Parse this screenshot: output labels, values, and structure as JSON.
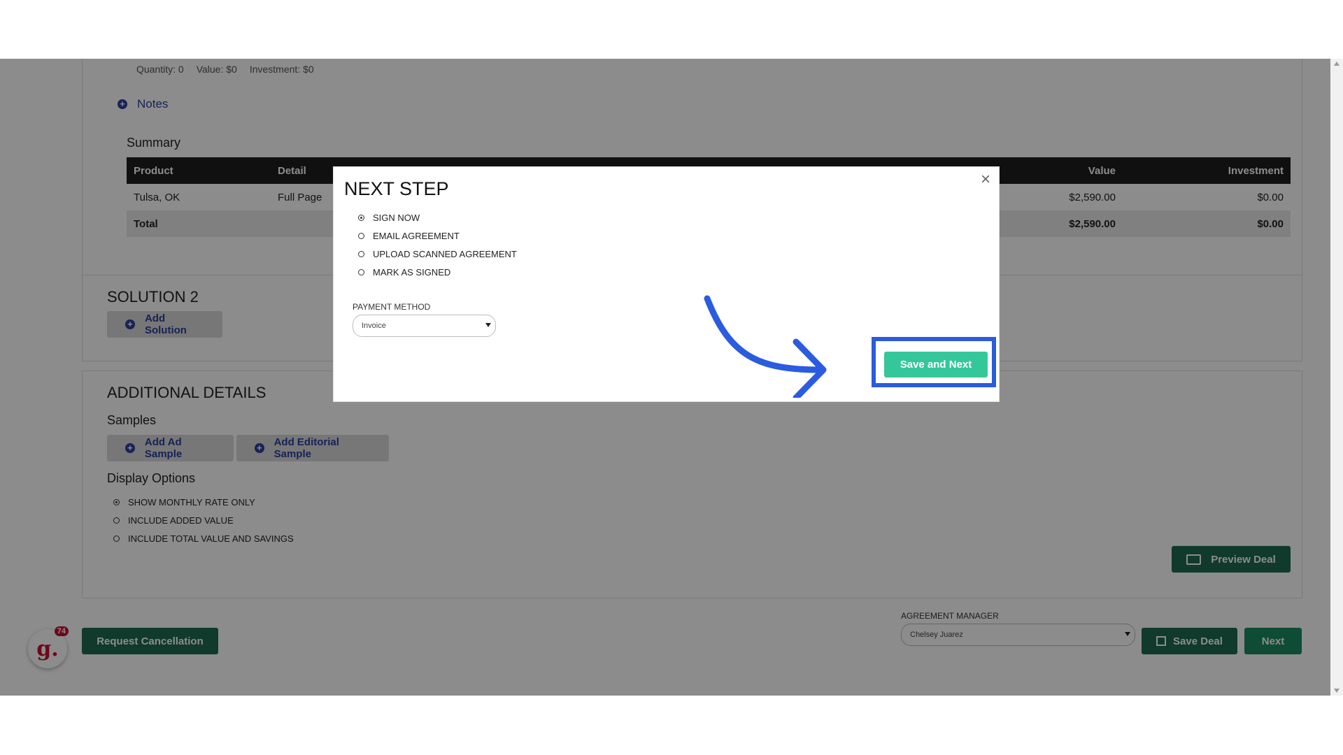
{
  "top_meta": {
    "quantity": "Quantity: 0",
    "value": "Value: $0",
    "investment": "Investment: $0"
  },
  "notes_label": "Notes",
  "summary": {
    "title": "Summary",
    "headers": [
      "Product",
      "Detail",
      "Value",
      "Investment"
    ],
    "rows": [
      {
        "product": "Tulsa, OK",
        "detail": "Full Page",
        "value": "$2,590.00",
        "investment": "$0.00"
      }
    ],
    "total": {
      "label": "Total",
      "value": "$2,590.00",
      "investment": "$0.00"
    }
  },
  "solution2": {
    "title": "SOLUTION 2",
    "add_label": "Add Solution"
  },
  "additional": {
    "title": "ADDITIONAL DETAILS",
    "samples_title": "Samples",
    "add_ad_sample": "Add Ad Sample",
    "add_editorial_sample": "Add Editorial Sample",
    "display_title": "Display Options",
    "display_options": [
      "SHOW MONTHLY RATE ONLY",
      "INCLUDE ADDED VALUE",
      "INCLUDE TOTAL VALUE AND SAVINGS"
    ],
    "preview_label": "Preview Deal"
  },
  "footer": {
    "request_cancellation": "Request Cancellation",
    "agreement_manager_label": "AGREEMENT MANAGER",
    "agreement_manager_value": "Chelsey Juarez",
    "save_deal": "Save Deal",
    "next": "Next"
  },
  "badge": {
    "letter": "g.",
    "count": "74"
  },
  "modal": {
    "title": "NEXT STEP",
    "close": "×",
    "options": [
      "SIGN NOW",
      "EMAIL AGREEMENT",
      "UPLOAD SCANNED AGREEMENT",
      "MARK AS SIGNED"
    ],
    "payment_label": "PAYMENT METHOD",
    "payment_value": "Invoice",
    "save_next": "Save and Next"
  },
  "colors": {
    "accent_green": "#1e6a4f",
    "modal_button": "#34c79a",
    "highlight": "#2a5be0",
    "link_blue": "#2b3f9e"
  }
}
